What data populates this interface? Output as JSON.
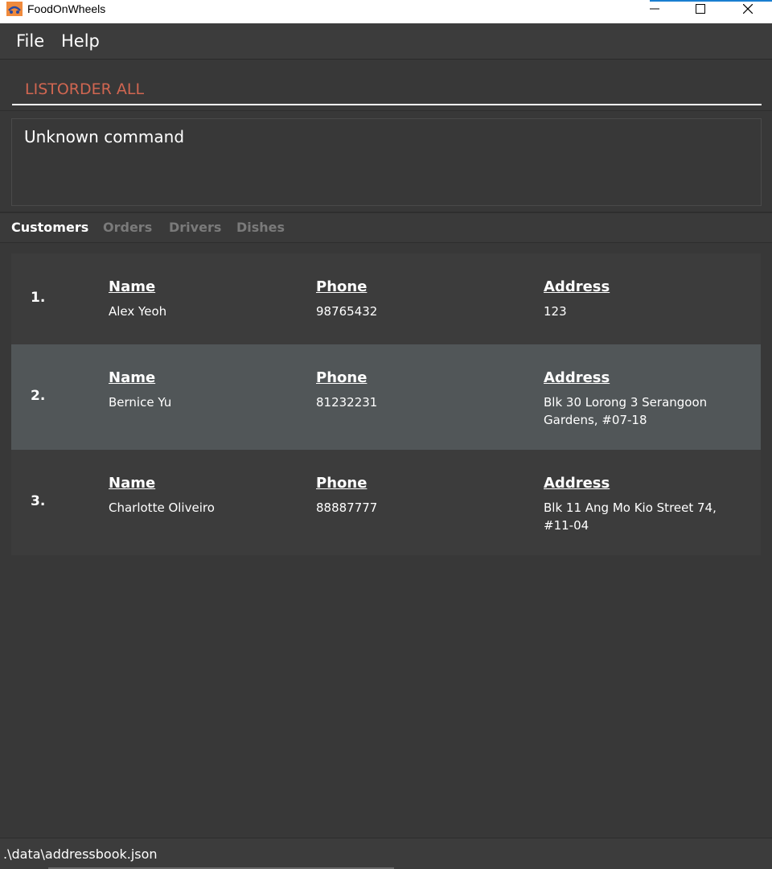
{
  "window": {
    "title": "FoodOnWheels",
    "icon": "food-truck-icon",
    "accent_color": "#1a7fd0"
  },
  "menu": {
    "items": [
      {
        "label": "File"
      },
      {
        "label": "Help"
      }
    ]
  },
  "command": {
    "value": "LISTORDER ALL",
    "error_color": "#d06651"
  },
  "result": {
    "text": "Unknown command"
  },
  "tabs": [
    {
      "label": "Customers",
      "active": true
    },
    {
      "label": "Orders",
      "active": false
    },
    {
      "label": "Drivers",
      "active": false
    },
    {
      "label": "Dishes",
      "active": false
    }
  ],
  "customers": {
    "headers": {
      "name": "Name",
      "phone": "Phone",
      "address": "Address"
    },
    "rows": [
      {
        "index": "1.",
        "name": "Alex Yeoh",
        "phone": "98765432",
        "address_lines": [
          "123",
          ""
        ]
      },
      {
        "index": "2.",
        "name": "Bernice Yu",
        "phone": "81232231",
        "address_lines": [
          "Blk 30 Lorong 3 Serangoon",
          "Gardens, #07-18"
        ]
      },
      {
        "index": "3.",
        "name": "Charlotte Oliveiro",
        "phone": "88887777",
        "address_lines": [
          "Blk 11 Ang Mo Kio Street 74,",
          "#11-04"
        ]
      }
    ],
    "selected_row_color": "#515658"
  },
  "status": {
    "path": ".\\data\\addressbook.json"
  }
}
